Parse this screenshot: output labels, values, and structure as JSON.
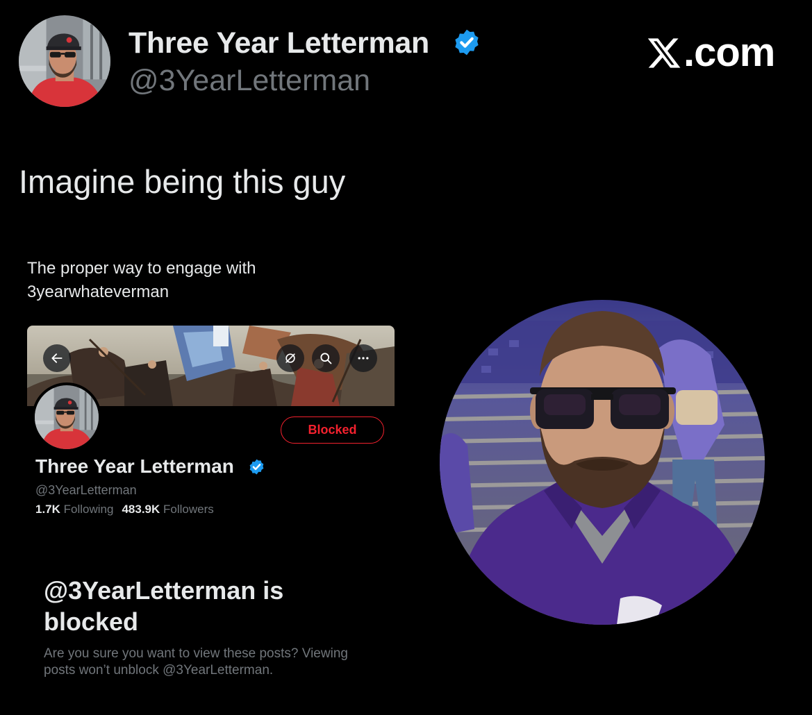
{
  "header": {
    "name": "Three Year Letterman",
    "handle": "@3YearLetterman",
    "verified_color": "#1d9bf0",
    "avatar_icon": "profile-avatar",
    "site_label": ".com",
    "site_logo_icon": "x-logo-icon"
  },
  "tweet": {
    "text": "Imagine being this guy"
  },
  "embedded": {
    "quote_text": "The proper way to engage with 3yearwhateverman",
    "nav": {
      "back_icon": "arrow-left-icon",
      "refresh_icon": "refresh-icon",
      "search_icon": "search-icon",
      "more_icon": "more-horizontal-icon"
    },
    "profile": {
      "name": "Three Year Letterman",
      "handle": "@3YearLetterman",
      "following_count": "1.7K",
      "following_label": "Following",
      "followers_count": "483.9K",
      "followers_label": "Followers",
      "blocked_button": "Blocked"
    },
    "blocked_notice": {
      "title": "@3YearLetterman is blocked",
      "description": "Are you sure you want to view these posts? Viewing posts won’t unblock @3YearLetterman."
    }
  },
  "colors": {
    "background": "#000000",
    "text_primary": "#e7e9ea",
    "text_secondary": "#71767b",
    "verified": "#1d9bf0",
    "blocked_red": "#f4212e",
    "shirt_purple": "#4b2a8c"
  }
}
